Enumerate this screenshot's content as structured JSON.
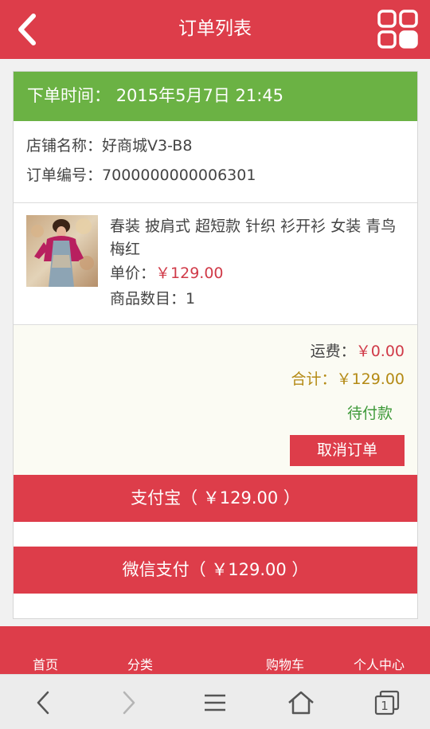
{
  "header": {
    "title": "订单列表",
    "back_icon": "chevron-left-icon",
    "menu_icon": "grid-icon"
  },
  "order": {
    "date_label": "下单时间：",
    "date_value": "2015年5月7日 21:45",
    "shop_label": "店铺名称：",
    "shop_name": "好商城V3-B8",
    "order_no_label": "订单编号：",
    "order_no": "7000000000006301",
    "item": {
      "name": "春装 披肩式 超短款 针织 衫开衫 女装 青鸟 梅红",
      "price_label": "单价：",
      "price": "￥129.00",
      "qty_label": "商品数目：",
      "qty": "1"
    },
    "shipping_label": "运费：",
    "shipping": "￥0.00",
    "total_label": "合计：",
    "total": "￥129.00",
    "status": "待付款",
    "cancel_label": "取消订单"
  },
  "payment": {
    "alipay_label": "支付宝（ ￥129.00 ）",
    "wechat_label": "微信支付（ ￥129.00 ）"
  },
  "app_nav": {
    "items": [
      "首页",
      "分类",
      "购物车",
      "个人中心"
    ]
  },
  "browser": {
    "icons": [
      "back-arrow-icon",
      "forward-arrow-icon",
      "menu-icon",
      "home-icon",
      "tabs-icon"
    ],
    "tab_count": "1"
  },
  "colors": {
    "primary": "#dd3d4a",
    "date_bar": "#6bb244",
    "status_green": "#3f9a3a",
    "total_gold": "#b48a14"
  }
}
